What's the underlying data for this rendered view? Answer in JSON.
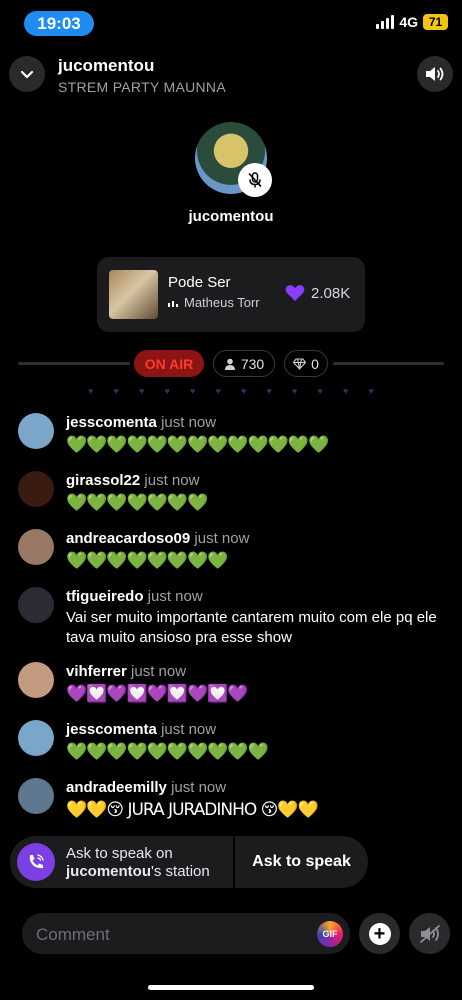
{
  "status_bar": {
    "time": "19:03",
    "network": "4G",
    "battery": "71"
  },
  "header": {
    "title": "jucomentou",
    "subtitle": "STREM PARTY MAUNNA"
  },
  "host": {
    "name": "jucomentou"
  },
  "music": {
    "song": "Pode Ser",
    "artist": "Matheus Torr",
    "likes": "2.08K"
  },
  "on_air": {
    "label": "ON AIR",
    "viewers": "730",
    "gems": "0"
  },
  "comments": [
    {
      "user": "jesscomenta",
      "time": "just now",
      "text": "💚💚💚💚💚💚💚💚💚💚💚💚💚",
      "emoji": true,
      "avatar_color": "#7aa7c9"
    },
    {
      "user": "girassol22",
      "time": "just now",
      "text": "💚💚💚💚💚💚💚",
      "emoji": true,
      "avatar_color": "#3a1b12"
    },
    {
      "user": "andreacardoso09",
      "time": "just now",
      "text": "💚💚💚💚💚💚💚💚",
      "emoji": true,
      "avatar_color": "#9a7866"
    },
    {
      "user": "tfigueiredo",
      "time": "just now",
      "text": "Vai ser muito importante cantarem muito com ele pq ele tava muito ansioso pra esse show",
      "emoji": false,
      "avatar_color": "#2b2b33"
    },
    {
      "user": "vihferrer",
      "time": "just now",
      "text": "💜💟💜💟💜💟💜💟💜",
      "emoji": true,
      "avatar_color": "#c49a80"
    },
    {
      "user": "jesscomenta",
      "time": "just now",
      "text": "💚💚💚💚💚💚💚💚💚💚",
      "emoji": true,
      "avatar_color": "#7aa7c9"
    },
    {
      "user": "andradeemilly",
      "time": "just now",
      "text": "💛💛😚 JURA JURADINHO 😚💛💛",
      "emoji": true,
      "avatar_color": "#5f7890"
    }
  ],
  "ask_to_speak": {
    "line1": "Ask to speak on",
    "station": "jucomentou",
    "line2_suffix": "'s station",
    "button": "Ask to speak"
  },
  "composer": {
    "placeholder": "Comment",
    "gif_label": "GIF",
    "plus": "+"
  },
  "colors": {
    "accent": "#7b3fe4",
    "on_air": "#ff3b30",
    "time_pill": "#1e8cf0",
    "battery": "#f2c511"
  },
  "icons": [
    "chevron-down-icon",
    "speaker-icon",
    "mic-off-icon",
    "heart-icon",
    "person-icon",
    "diamond-icon",
    "phone-wave-icon",
    "speaker-wave-icon"
  ]
}
